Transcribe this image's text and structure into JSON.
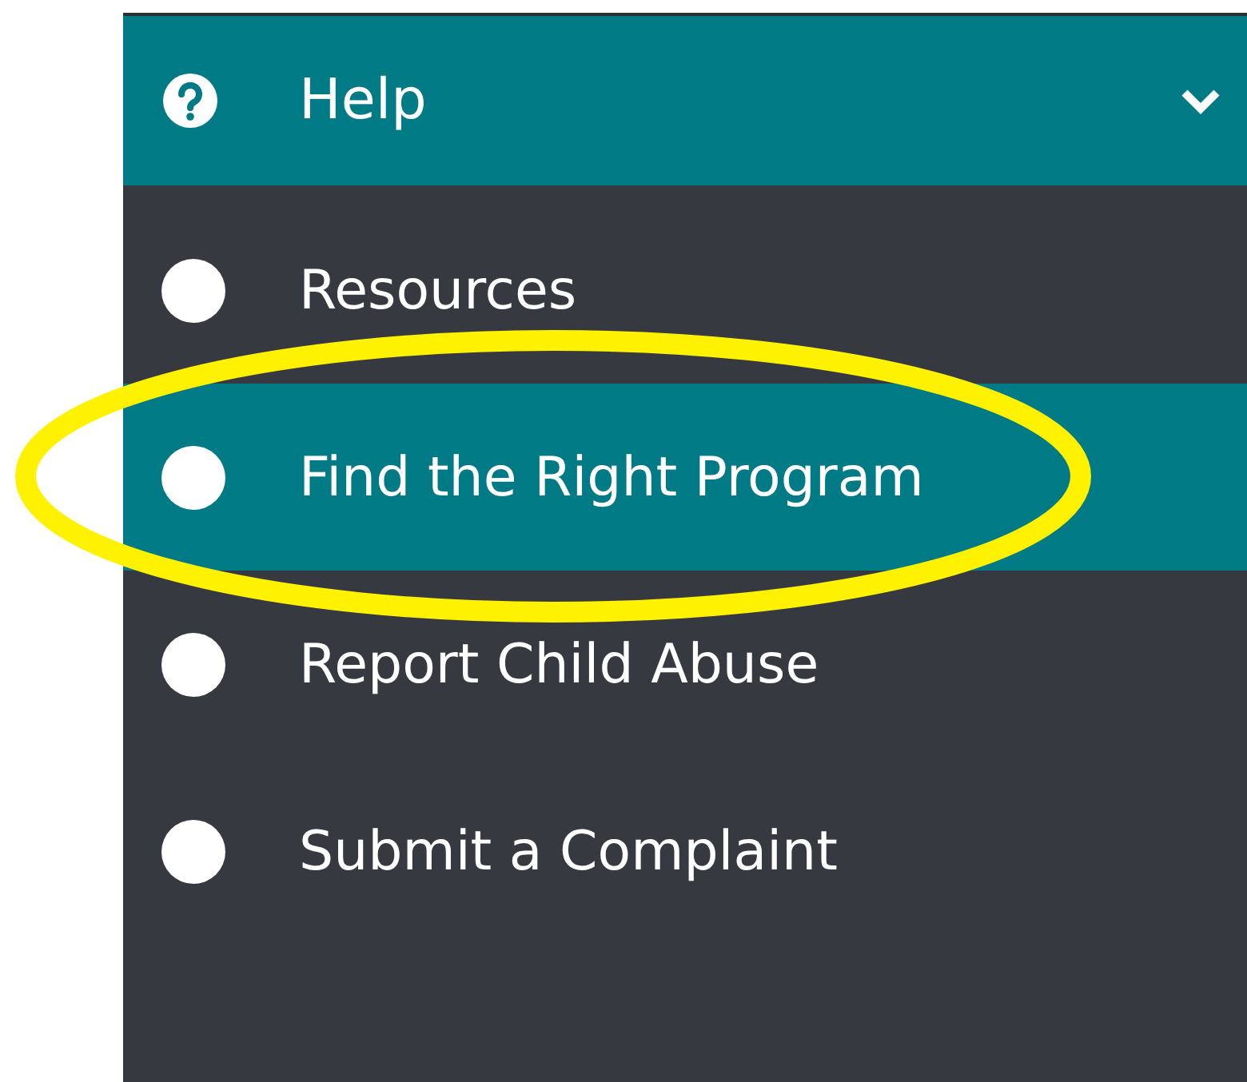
{
  "menu": {
    "title": "Help",
    "expanded": true,
    "items": [
      {
        "label": "Resources",
        "selected": false
      },
      {
        "label": "Find the Right Program",
        "selected": true
      },
      {
        "label": "Report Child Abuse",
        "selected": false
      },
      {
        "label": "Submit a Complaint",
        "selected": false
      }
    ]
  },
  "annotation": {
    "kind": "ellipse"
  }
}
